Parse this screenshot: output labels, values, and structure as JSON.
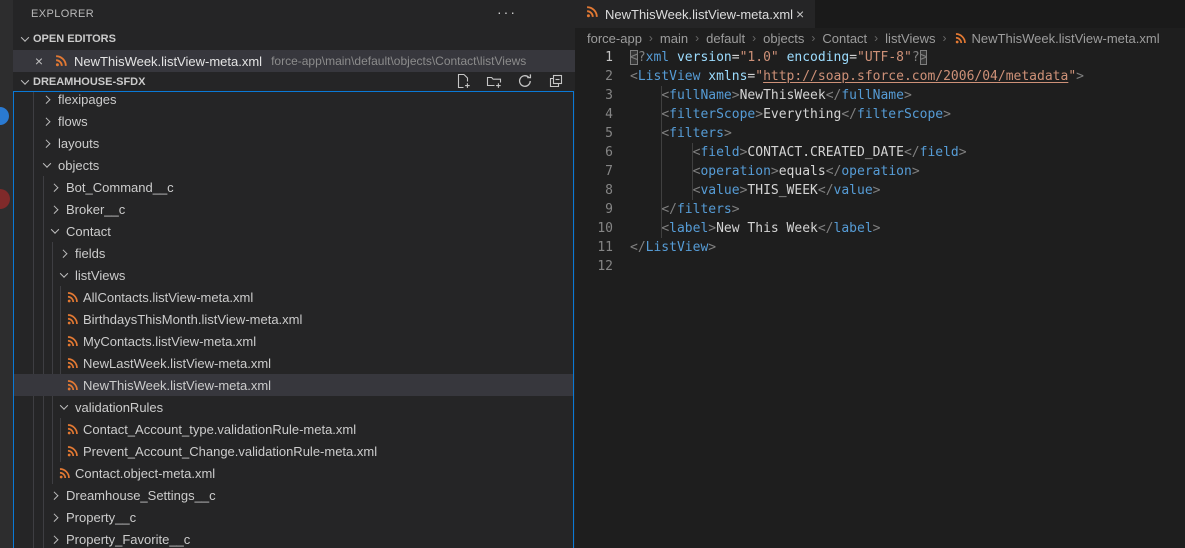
{
  "colors": {
    "focus_border": "#0a79d6",
    "selection_bg": "#37373d",
    "xml_icon_orange": "#e37933",
    "badge_blue": "#2a7ad2",
    "badge_red": "#7f2a2a",
    "tag_blue": "#569cd6",
    "attr_blue": "#9cdcfe",
    "string_orange": "#ce9178"
  },
  "icons": {
    "close": "×",
    "more": "···"
  },
  "explorer": {
    "title": "EXPLORER",
    "open_editors": {
      "header": "OPEN EDITORS",
      "items": [
        {
          "name": "NewThisWeek.listView-meta.xml",
          "path": "force-app\\main\\default\\objects\\Contact\\listViews",
          "active": true
        }
      ]
    },
    "workspace": {
      "name": "DREAMHOUSE-SFDX",
      "actions": [
        {
          "name": "new-file"
        },
        {
          "name": "new-folder"
        },
        {
          "name": "refresh-explorer"
        },
        {
          "name": "collapse-folders"
        }
      ],
      "tree": [
        {
          "label": "flexipages",
          "level": 1,
          "kind": "folder",
          "state": "collapsed"
        },
        {
          "label": "flows",
          "level": 1,
          "kind": "folder",
          "state": "collapsed"
        },
        {
          "label": "layouts",
          "level": 1,
          "kind": "folder",
          "state": "collapsed"
        },
        {
          "label": "objects",
          "level": 1,
          "kind": "folder",
          "state": "expanded"
        },
        {
          "label": "Bot_Command__c",
          "level": 2,
          "kind": "folder",
          "state": "collapsed"
        },
        {
          "label": "Broker__c",
          "level": 2,
          "kind": "folder",
          "state": "collapsed"
        },
        {
          "label": "Contact",
          "level": 2,
          "kind": "folder",
          "state": "expanded"
        },
        {
          "label": "fields",
          "level": 3,
          "kind": "folder",
          "state": "collapsed"
        },
        {
          "label": "listViews",
          "level": 3,
          "kind": "folder",
          "state": "expanded"
        },
        {
          "label": "AllContacts.listView-meta.xml",
          "level": 4,
          "kind": "xml-file"
        },
        {
          "label": "BirthdaysThisMonth.listView-meta.xml",
          "level": 4,
          "kind": "xml-file"
        },
        {
          "label": "MyContacts.listView-meta.xml",
          "level": 4,
          "kind": "xml-file"
        },
        {
          "label": "NewLastWeek.listView-meta.xml",
          "level": 4,
          "kind": "xml-file"
        },
        {
          "label": "NewThisWeek.listView-meta.xml",
          "level": 4,
          "kind": "xml-file",
          "selected": true
        },
        {
          "label": "validationRules",
          "level": 3,
          "kind": "folder",
          "state": "expanded"
        },
        {
          "label": "Contact_Account_type.validationRule-meta.xml",
          "level": 4,
          "kind": "xml-file"
        },
        {
          "label": "Prevent_Account_Change.validationRule-meta.xml",
          "level": 4,
          "kind": "xml-file"
        },
        {
          "label": "Contact.object-meta.xml",
          "level": 3,
          "kind": "xml-file"
        },
        {
          "label": "Dreamhouse_Settings__c",
          "level": 2,
          "kind": "folder",
          "state": "collapsed"
        },
        {
          "label": "Property__c",
          "level": 2,
          "kind": "folder",
          "state": "collapsed"
        },
        {
          "label": "Property_Favorite__c",
          "level": 2,
          "kind": "folder",
          "state": "collapsed"
        }
      ]
    }
  },
  "editor": {
    "tabs": [
      {
        "title": "NewThisWeek.listView-meta.xml",
        "active": true
      }
    ],
    "breadcrumbs": [
      "force-app",
      "main",
      "default",
      "objects",
      "Contact",
      "listViews",
      "NewThisWeek.listView-meta.xml"
    ],
    "code": {
      "language": "xml",
      "lines": [
        {
          "n": 1,
          "active": true,
          "tokens": [
            [
              "m",
              "<"
            ],
            [
              "k",
              "?"
            ],
            [
              "t",
              "xml"
            ],
            [
              "x",
              " "
            ],
            [
              "a",
              "version"
            ],
            [
              "x",
              "="
            ],
            [
              "s",
              "\"1.0\""
            ],
            [
              "x",
              " "
            ],
            [
              "a",
              "encoding"
            ],
            [
              "x",
              "="
            ],
            [
              "s",
              "\"UTF-8\""
            ],
            [
              "k",
              "?"
            ],
            [
              "m",
              ">"
            ]
          ]
        },
        {
          "n": 2,
          "tokens": [
            [
              "k",
              "<"
            ],
            [
              "t",
              "ListView"
            ],
            [
              "x",
              " "
            ],
            [
              "a",
              "xmlns"
            ],
            [
              "x",
              "="
            ],
            [
              "s",
              "\""
            ],
            [
              "l",
              "http://soap.sforce.com/2006/04/metadata"
            ],
            [
              "s",
              "\""
            ],
            [
              "k",
              ">"
            ]
          ]
        },
        {
          "n": 3,
          "tokens": [
            [
              "x",
              "    "
            ],
            [
              "k",
              "<"
            ],
            [
              "t",
              "fullName"
            ],
            [
              "k",
              ">"
            ],
            [
              "x",
              "NewThisWeek"
            ],
            [
              "k",
              "</"
            ],
            [
              "t",
              "fullName"
            ],
            [
              "k",
              ">"
            ]
          ]
        },
        {
          "n": 4,
          "tokens": [
            [
              "x",
              "    "
            ],
            [
              "k",
              "<"
            ],
            [
              "t",
              "filterScope"
            ],
            [
              "k",
              ">"
            ],
            [
              "x",
              "Everything"
            ],
            [
              "k",
              "</"
            ],
            [
              "t",
              "filterScope"
            ],
            [
              "k",
              ">"
            ]
          ]
        },
        {
          "n": 5,
          "tokens": [
            [
              "x",
              "    "
            ],
            [
              "k",
              "<"
            ],
            [
              "t",
              "filters"
            ],
            [
              "k",
              ">"
            ]
          ]
        },
        {
          "n": 6,
          "tokens": [
            [
              "x",
              "        "
            ],
            [
              "k",
              "<"
            ],
            [
              "t",
              "field"
            ],
            [
              "k",
              ">"
            ],
            [
              "x",
              "CONTACT.CREATED_DATE"
            ],
            [
              "k",
              "</"
            ],
            [
              "t",
              "field"
            ],
            [
              "k",
              ">"
            ]
          ]
        },
        {
          "n": 7,
          "tokens": [
            [
              "x",
              "        "
            ],
            [
              "k",
              "<"
            ],
            [
              "t",
              "operation"
            ],
            [
              "k",
              ">"
            ],
            [
              "x",
              "equals"
            ],
            [
              "k",
              "</"
            ],
            [
              "t",
              "operation"
            ],
            [
              "k",
              ">"
            ]
          ]
        },
        {
          "n": 8,
          "tokens": [
            [
              "x",
              "        "
            ],
            [
              "k",
              "<"
            ],
            [
              "t",
              "value"
            ],
            [
              "k",
              ">"
            ],
            [
              "x",
              "THIS_WEEK"
            ],
            [
              "k",
              "</"
            ],
            [
              "t",
              "value"
            ],
            [
              "k",
              ">"
            ]
          ]
        },
        {
          "n": 9,
          "tokens": [
            [
              "x",
              "    "
            ],
            [
              "k",
              "</"
            ],
            [
              "t",
              "filters"
            ],
            [
              "k",
              ">"
            ]
          ]
        },
        {
          "n": 10,
          "tokens": [
            [
              "x",
              "    "
            ],
            [
              "k",
              "<"
            ],
            [
              "t",
              "label"
            ],
            [
              "k",
              ">"
            ],
            [
              "x",
              "New This Week"
            ],
            [
              "k",
              "</"
            ],
            [
              "t",
              "label"
            ],
            [
              "k",
              ">"
            ]
          ]
        },
        {
          "n": 11,
          "tokens": [
            [
              "k",
              "</"
            ],
            [
              "t",
              "ListView"
            ],
            [
              "k",
              ">"
            ]
          ]
        },
        {
          "n": 12,
          "tokens": []
        }
      ]
    }
  }
}
